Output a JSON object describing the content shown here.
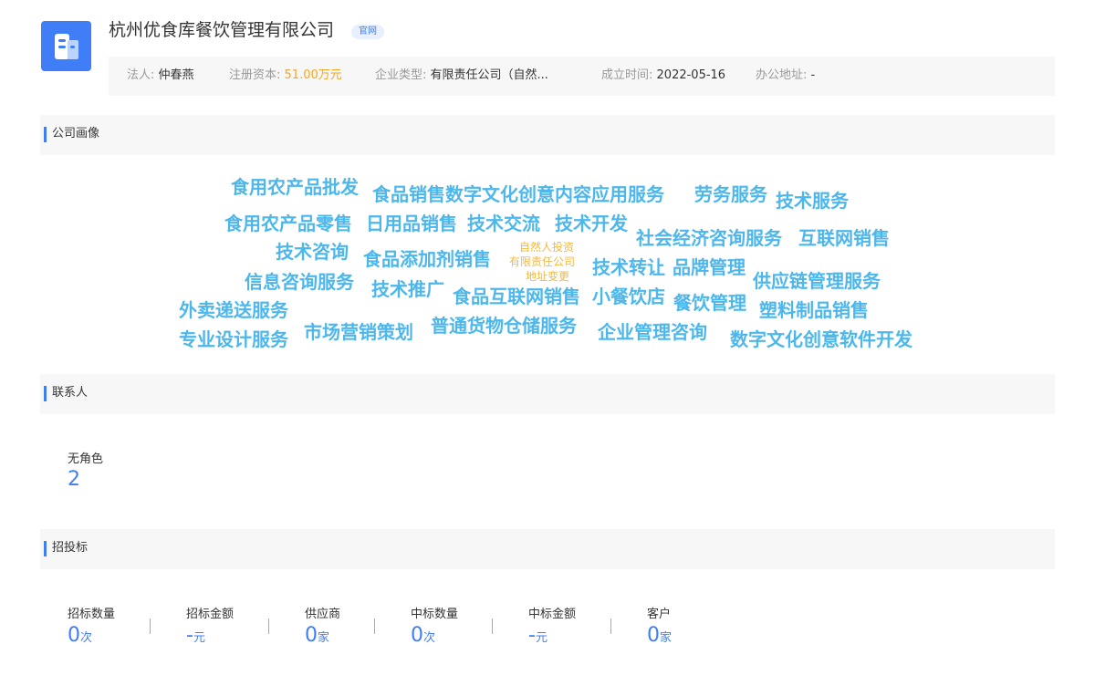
{
  "company": {
    "name": "杭州优食库餐饮管理有限公司",
    "official_site_badge": "官网"
  },
  "info": {
    "legal_person_label": "法人:",
    "legal_person": "仲春燕",
    "capital_label": "注册资本:",
    "capital": "51.00万元",
    "type_label": "企业类型:",
    "type": "有限责任公司（自然...",
    "established_label": "成立时间:",
    "established": "2022-05-16",
    "address_label": "办公地址:",
    "address": "-"
  },
  "sections": {
    "profile": "公司画像",
    "contacts": "联系人",
    "bidding": "招投标"
  },
  "word_cloud": [
    "食用农产品批发",
    "食品销售",
    "数字文化创意内容应用服务",
    "劳务服务",
    "技术服务",
    "食用农产品零售",
    "日用品销售",
    "技术交流",
    "技术开发",
    "社会经济咨询服务",
    "互联网销售",
    "技术咨询",
    "食品添加剂销售",
    "自然人投资",
    "有限责任公司",
    "地址变更",
    "技术转让",
    "品牌管理",
    "信息咨询服务",
    "技术推广",
    "食品互联网销售",
    "小餐饮店",
    "餐饮管理",
    "供应链管理服务",
    "外卖递送服务",
    "塑料制品销售",
    "专业设计服务",
    "市场营销策划",
    "普通货物仓储服务",
    "企业管理咨询",
    "数字文化创意软件开发"
  ],
  "contacts": {
    "label": "无角色",
    "count": "2"
  },
  "bidding": [
    {
      "label": "招标数量",
      "value": "0",
      "unit": "次"
    },
    {
      "label": "招标金额",
      "value": "-",
      "unit": "元"
    },
    {
      "label": "供应商",
      "value": "0",
      "unit": "家"
    },
    {
      "label": "中标数量",
      "value": "0",
      "unit": "次"
    },
    {
      "label": "中标金额",
      "value": "-",
      "unit": "元"
    },
    {
      "label": "客户",
      "value": "0",
      "unit": "家"
    }
  ],
  "colors": {
    "accent": "#3f7ef7",
    "word_cloud_main": "#4cb7ec",
    "word_cloud_small": "#f5b83d",
    "capital": "#f5a623"
  }
}
